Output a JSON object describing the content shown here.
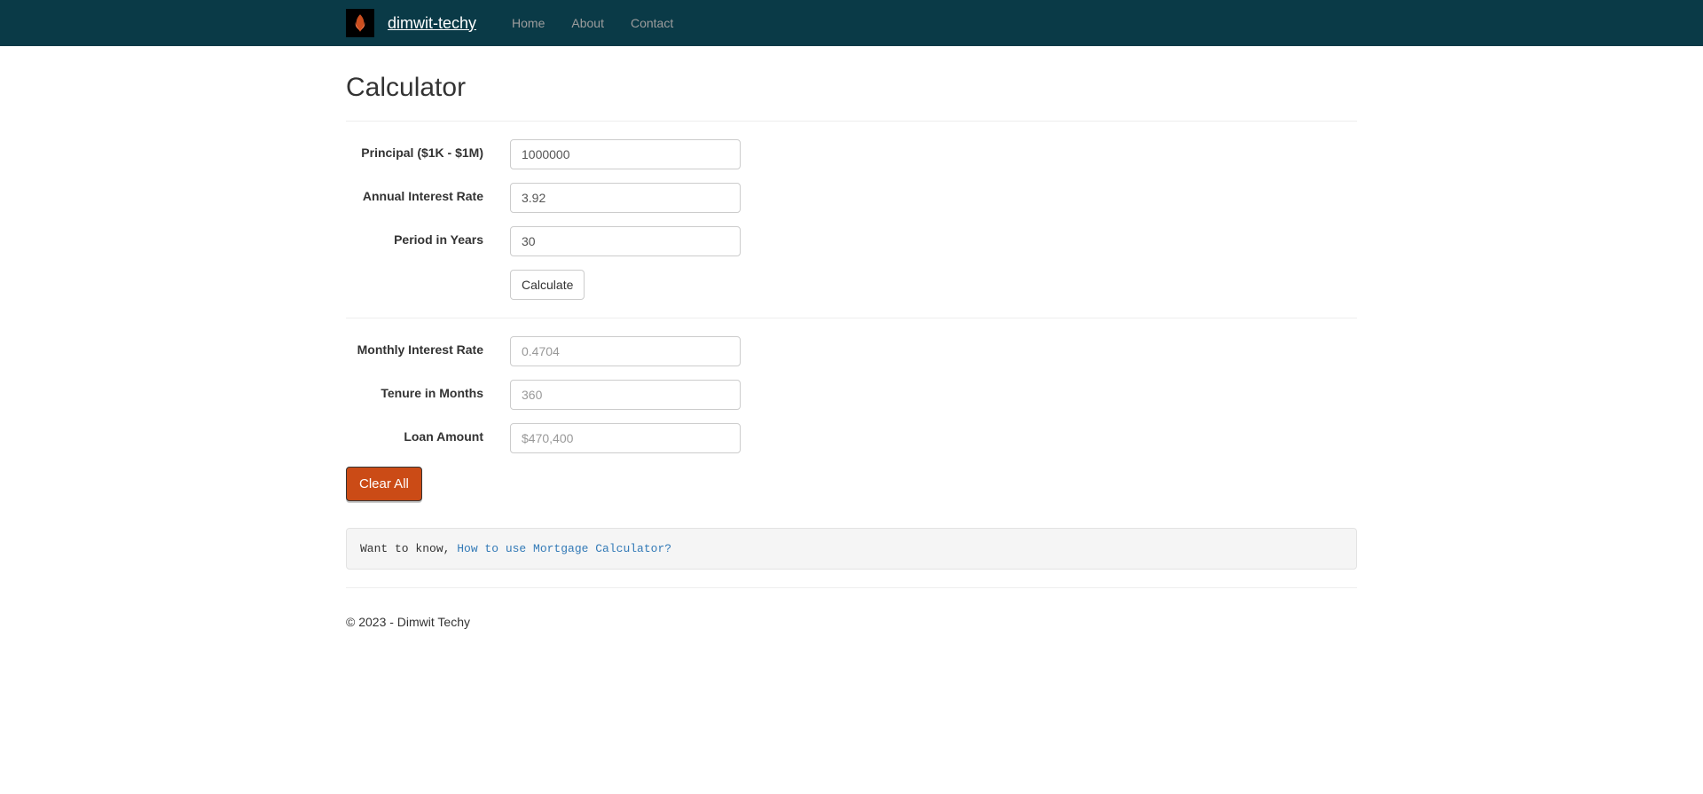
{
  "nav": {
    "brand": "dimwit-techy",
    "items": [
      "Home",
      "About",
      "Contact"
    ]
  },
  "page": {
    "title": "Calculator"
  },
  "form": {
    "principal": {
      "label": "Principal ($1K - $1M)",
      "value": "1000000"
    },
    "annual_rate": {
      "label": "Annual Interest Rate",
      "value": "3.92"
    },
    "period_years": {
      "label": "Period in Years",
      "value": "30"
    },
    "calculate_btn": "Calculate",
    "monthly_rate": {
      "label": "Monthly Interest Rate",
      "value": "0.4704"
    },
    "tenure_months": {
      "label": "Tenure in Months",
      "value": "360"
    },
    "loan_amount": {
      "label": "Loan Amount",
      "value": "$470,400"
    },
    "clear_btn": "Clear All"
  },
  "well": {
    "prefix": "Want to know, ",
    "link": "How to use Mortgage Calculator?"
  },
  "footer": {
    "text": "© 2023 - Dimwit Techy"
  }
}
